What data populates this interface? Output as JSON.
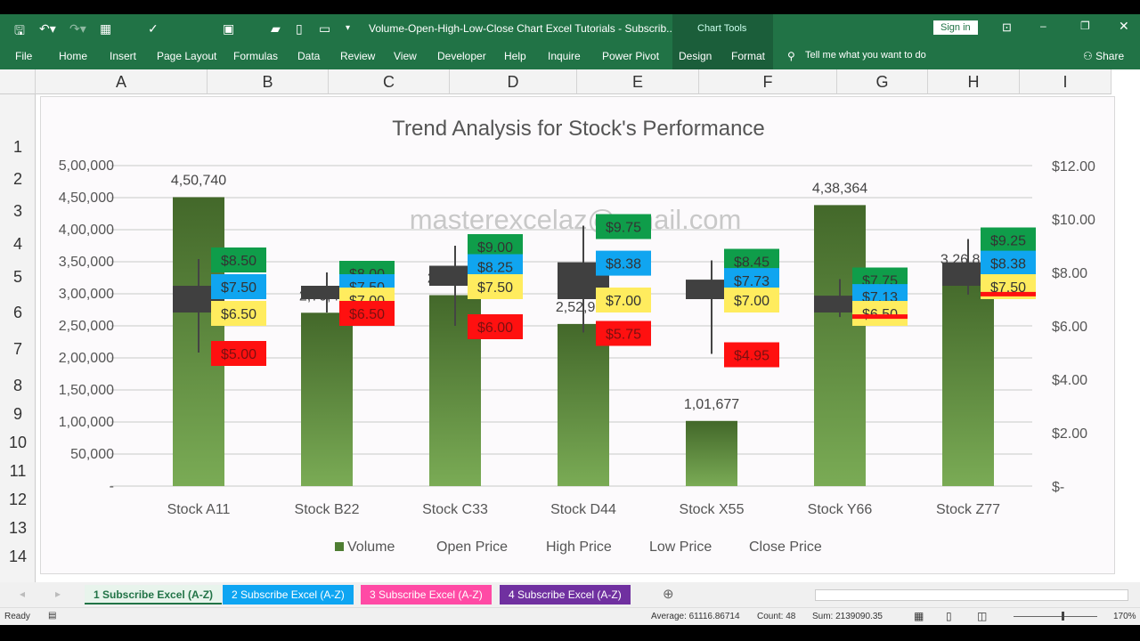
{
  "window": {
    "title": "Volume-Open-High-Low-Close Chart Excel Tutorials - Subscrib...",
    "context_tab": "Chart Tools",
    "sign_in": "Sign in"
  },
  "ribbon": {
    "tabs": [
      "File",
      "Home",
      "Insert",
      "Page Layout",
      "Formulas",
      "Data",
      "Review",
      "View",
      "Developer",
      "Help",
      "Inquire",
      "Power Pivot",
      "Design",
      "Format"
    ],
    "tell_me": "Tell me what you want to do",
    "share": "Share"
  },
  "columns": [
    "A",
    "B",
    "C",
    "D",
    "E",
    "F",
    "G",
    "H",
    "I"
  ],
  "rows": [
    "1",
    "2",
    "3",
    "4",
    "5",
    "6",
    "7",
    "8",
    "9",
    "10",
    "11",
    "12",
    "13",
    "14"
  ],
  "watermark": "masterexcelaz@gmail.com",
  "chart_data": {
    "type": "stock-volume-ohlc",
    "title": "Trend Analysis for Stock's Performance",
    "categories": [
      "Stock A11",
      "Stock B22",
      "Stock C33",
      "Stock D44",
      "Stock X55",
      "Stock Y66",
      "Stock Z77"
    ],
    "volume": [
      450740,
      270423,
      297865,
      252933,
      101677,
      438364,
      326882
    ],
    "volume_labels": [
      "4,50,740",
      "2,70,423",
      "2,97,865",
      "2,52,933",
      "1,01,677",
      "4,38,364",
      "3,26,882"
    ],
    "open": [
      7.5,
      7.5,
      8.25,
      8.38,
      7.73,
      7.13,
      8.38
    ],
    "high": [
      8.5,
      8.0,
      9.0,
      9.75,
      8.45,
      7.75,
      9.25
    ],
    "low": [
      5.0,
      6.5,
      6.0,
      5.75,
      4.95,
      6.33,
      7.17
    ],
    "close": [
      6.5,
      7.0,
      7.5,
      7.0,
      7.0,
      6.5,
      7.5
    ],
    "price_labels": {
      "open": [
        "$7.50",
        "$7.50",
        "$8.25",
        "$8.38",
        "$7.73",
        "$7.13",
        "$8.38"
      ],
      "high": [
        "$8.50",
        "$8.00",
        "$9.00",
        "$9.75",
        "$8.45",
        "$7.75",
        "$9.25"
      ],
      "low": [
        "$5.00",
        "$6.50",
        "$6.00",
        "$5.75",
        "$4.95",
        "",
        ""
      ],
      "close": [
        "$6.50",
        "$7.00",
        "$7.50",
        "$7.00",
        "$7.00",
        "$6.50",
        "$7.50"
      ]
    },
    "left_axis": {
      "range": [
        0,
        500000
      ],
      "ticks": [
        "-",
        "50,000",
        "1,00,000",
        "1,50,000",
        "2,00,000",
        "2,50,000",
        "3,00,000",
        "3,50,000",
        "4,00,000",
        "4,50,000",
        "5,00,000"
      ]
    },
    "right_axis": {
      "range": [
        0,
        12
      ],
      "ticks": [
        "$-",
        "$2.00",
        "$4.00",
        "$6.00",
        "$8.00",
        "$10.00",
        "$12.00"
      ]
    },
    "legend": {
      "placement": "bottom",
      "entries": [
        "Volume",
        "Open Price",
        "High Price",
        "Low Price",
        "Close Price"
      ]
    },
    "grid": true,
    "colors": {
      "volume": "#4e7d32",
      "candle": "#404040",
      "high": "#0f9d4a",
      "open": "#10a5f0",
      "close": "#ffec5e",
      "low": "#ff1010"
    }
  },
  "sheet_tabs": [
    {
      "label": "1 Subscribe Excel (A-Z)",
      "color": "#e8f4ec"
    },
    {
      "label": "2 Subscribe Excel (A-Z)",
      "color": "#0ea5f2"
    },
    {
      "label": "3 Subscribe Excel (A-Z)",
      "color": "#ff4aa5"
    },
    {
      "label": "4 Subscribe Excel (A-Z)",
      "color": "#7030a0"
    }
  ],
  "status": {
    "ready": "Ready",
    "average": "Average: 61116.86714",
    "count": "Count: 48",
    "sum": "Sum: 2139090.35",
    "zoom": "170%"
  }
}
